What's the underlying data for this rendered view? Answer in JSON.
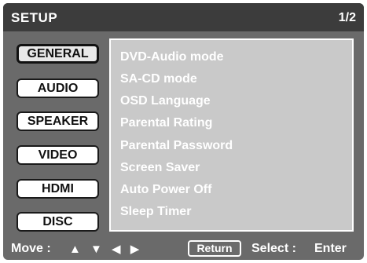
{
  "header": {
    "title": "SETUP",
    "page": "1/2"
  },
  "tabs": [
    {
      "label": "GENERAL",
      "active": true
    },
    {
      "label": "AUDIO",
      "active": false
    },
    {
      "label": "SPEAKER",
      "active": false
    },
    {
      "label": "VIDEO",
      "active": false
    },
    {
      "label": "HDMI",
      "active": false
    },
    {
      "label": "DISC",
      "active": false
    }
  ],
  "menu": [
    "DVD-Audio mode",
    "SA-CD mode",
    "OSD Language",
    "Parental Rating",
    "Parental Password",
    "Screen Saver",
    "Auto Power Off",
    "Sleep Timer"
  ],
  "footer": {
    "move_label": "Move :",
    "arrows": "▲ ▼ ◀ ▶",
    "return_label": "Return",
    "select_label": "Select :",
    "enter_label": "Enter"
  },
  "colors": {
    "title_bar": "#3c3c3c",
    "panel": "#6a6a6a",
    "content": "#c9c9c9"
  }
}
